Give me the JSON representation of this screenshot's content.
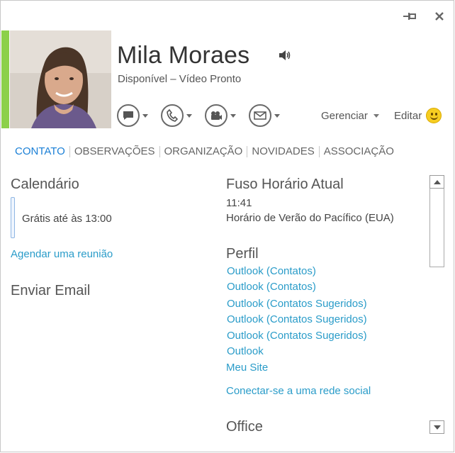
{
  "window": {
    "pin_icon": "pin-icon",
    "close_icon": "close-icon"
  },
  "contact": {
    "name": "Mila Moraes",
    "status": "Disponível – Vídeo Pronto",
    "presence_color": "#8cd04a"
  },
  "actions": [
    {
      "icon": "chat-bubble-icon"
    },
    {
      "icon": "phone-icon"
    },
    {
      "icon": "video-camera-icon"
    },
    {
      "icon": "email-icon"
    }
  ],
  "header": {
    "manage_label": "Gerenciar",
    "edit_label": "Editar"
  },
  "tabs": [
    {
      "label": "CONTATO",
      "active": true
    },
    {
      "label": "OBSERVAÇÕES"
    },
    {
      "label": "ORGANIZAÇÃO"
    },
    {
      "label": "NOVIDADES"
    },
    {
      "label": "ASSOCIAÇÃO"
    }
  ],
  "left": {
    "calendar_title": "Calendário",
    "calendar_free": "Grátis até às 13:00",
    "schedule_link": "Agendar uma reunião",
    "email_title": "Enviar Email"
  },
  "right": {
    "timezone_title": "Fuso Horário Atual",
    "time": "11:41",
    "timezone_name": "Horário de Verão do Pacífico (EUA)",
    "profile_title": "Perfil",
    "profile_links": [
      "Outlook (Contatos)",
      "Outlook (Contatos)",
      "Outlook (Contatos Sugeridos)",
      "Outlook (Contatos Sugeridos)",
      "Outlook (Contatos Sugeridos)",
      "Outlook",
      "Meu Site"
    ],
    "social_link": "Conectar-se a uma rede social",
    "office_title": "Office"
  },
  "colors": {
    "accent": "#1a7fd6",
    "link": "#2a9cc9"
  }
}
